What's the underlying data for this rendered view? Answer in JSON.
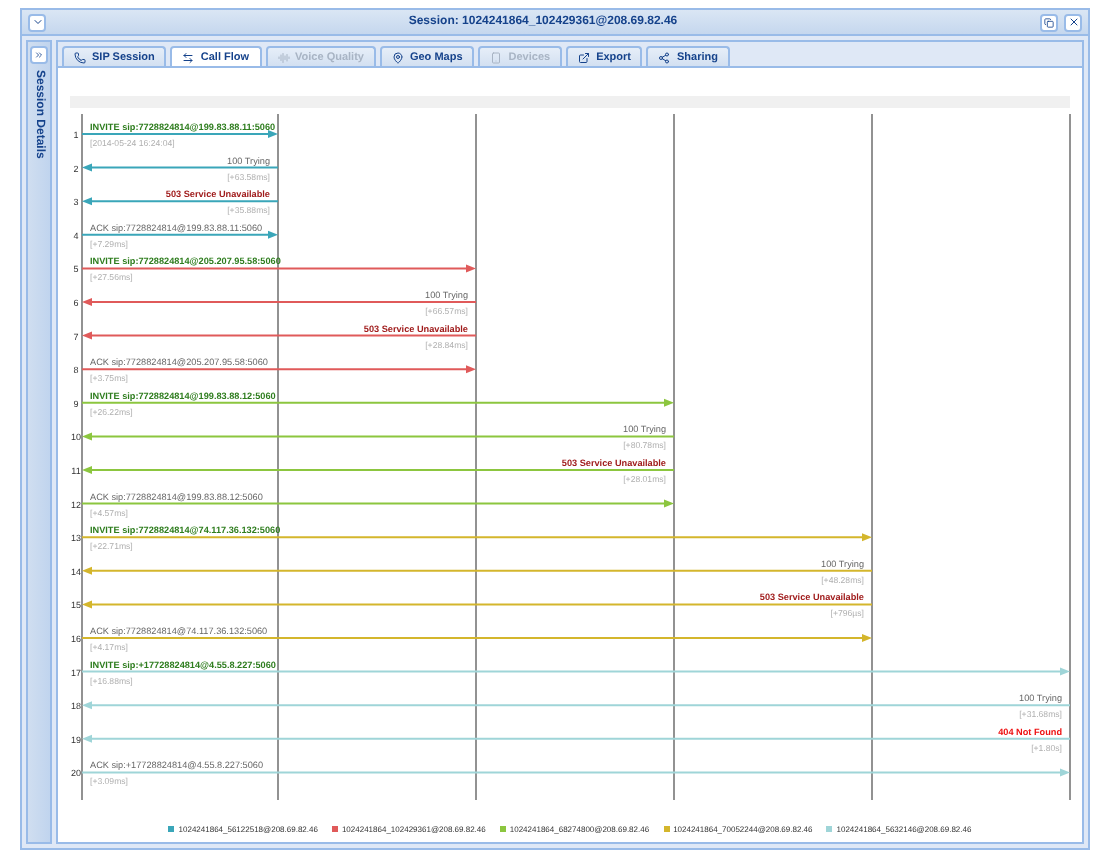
{
  "window": {
    "title": "Session: 1024241864_102429361@208.69.82.46"
  },
  "sidebar": {
    "label": "Session Details"
  },
  "tabs": [
    {
      "label": "SIP Session",
      "selected": false,
      "disabled": false
    },
    {
      "label": "Call Flow",
      "selected": true,
      "disabled": false
    },
    {
      "label": "Voice Quality",
      "selected": false,
      "disabled": true
    },
    {
      "label": "Geo Maps",
      "selected": false,
      "disabled": false
    },
    {
      "label": "Devices",
      "selected": false,
      "disabled": true
    },
    {
      "label": "Export",
      "selected": false,
      "disabled": false
    },
    {
      "label": "Sharing",
      "selected": false,
      "disabled": false
    }
  ],
  "dialogs": [
    {
      "legend": "1024241864_56122518@208.69.82.46",
      "color": "#3aa6b9",
      "messages": [
        {
          "row": "1",
          "kind": "request",
          "label": "INVITE sip:7728824814@199.83.88.11:5060",
          "time": "[2014-05-24 16:24:04]"
        },
        {
          "row": "2",
          "kind": "provisional",
          "label": "100 Trying",
          "time": "[+63.58ms]"
        },
        {
          "row": "3",
          "kind": "server_error",
          "label": "503 Service Unavailable",
          "time": "[+35.88ms]"
        },
        {
          "row": "4",
          "kind": "ack",
          "label": "ACK sip:7728824814@199.83.88.11:5060",
          "time": "[+7.29ms]"
        }
      ]
    },
    {
      "legend": "1024241864_102429361@208.69.82.46",
      "color": "#e05a5a",
      "messages": [
        {
          "row": "5",
          "kind": "request",
          "label": "INVITE sip:7728824814@205.207.95.58:5060",
          "time": "[+27.56ms]"
        },
        {
          "row": "6",
          "kind": "provisional",
          "label": "100 Trying",
          "time": "[+66.57ms]"
        },
        {
          "row": "7",
          "kind": "server_error",
          "label": "503 Service Unavailable",
          "time": "[+28.84ms]"
        },
        {
          "row": "8",
          "kind": "ack",
          "label": "ACK sip:7728824814@205.207.95.58:5060",
          "time": "[+3.75ms]"
        }
      ]
    },
    {
      "legend": "1024241864_68274800@208.69.82.46",
      "color": "#8cc63f",
      "messages": [
        {
          "row": "9",
          "kind": "request",
          "label": "INVITE sip:7728824814@199.83.88.12:5060",
          "time": "[+26.22ms]"
        },
        {
          "row": "10",
          "kind": "provisional",
          "label": "100 Trying",
          "time": "[+80.78ms]"
        },
        {
          "row": "11",
          "kind": "server_error",
          "label": "503 Service Unavailable",
          "time": "[+28.01ms]"
        },
        {
          "row": "12",
          "kind": "ack",
          "label": "ACK sip:7728824814@199.83.88.12:5060",
          "time": "[+4.57ms]"
        }
      ]
    },
    {
      "legend": "1024241864_70052244@208.69.82.46",
      "color": "#d4b62c",
      "messages": [
        {
          "row": "13",
          "kind": "request",
          "label": "INVITE sip:7728824814@74.117.36.132:5060",
          "time": "[+22.71ms]"
        },
        {
          "row": "14",
          "kind": "provisional",
          "label": "100 Trying",
          "time": "[+48.28ms]"
        },
        {
          "row": "15",
          "kind": "server_error",
          "label": "503 Service Unavailable",
          "time": "[+796µs]"
        },
        {
          "row": "16",
          "kind": "ack",
          "label": "ACK sip:7728824814@74.117.36.132:5060",
          "time": "[+4.17ms]"
        }
      ]
    },
    {
      "legend": "1024241864_5632146@208.69.82.46",
      "color": "#9fd5d8",
      "messages": [
        {
          "row": "17",
          "kind": "request",
          "label": "INVITE sip:+17728824814@4.55.8.227:5060",
          "time": "[+16.88ms]"
        },
        {
          "row": "18",
          "kind": "provisional",
          "label": "100 Trying",
          "time": "[+31.68ms]"
        },
        {
          "row": "19",
          "kind": "client_error",
          "label": "404 Not Found",
          "time": "[+1.80s]"
        },
        {
          "row": "20",
          "kind": "ack",
          "label": "ACK sip:+17728824814@4.55.8.227:5060",
          "time": "[+3.09ms]"
        }
      ]
    }
  ]
}
